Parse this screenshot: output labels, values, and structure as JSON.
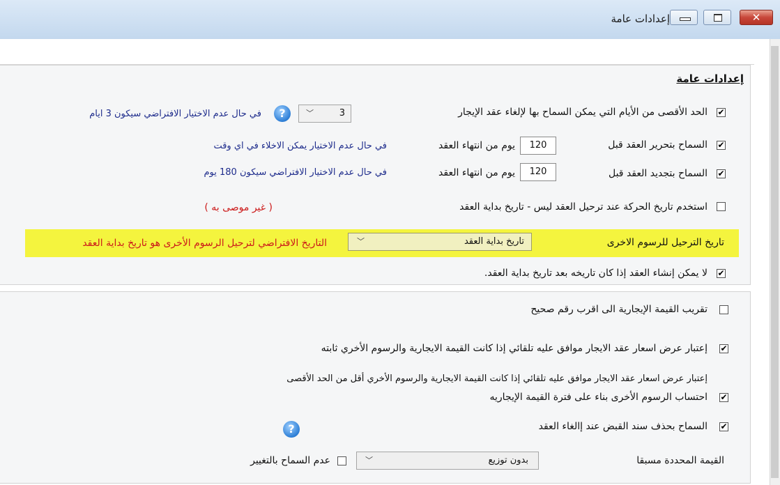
{
  "window": {
    "title": "إعدادات عامة"
  },
  "section_title": "إعدادات عامة",
  "general": {
    "max_cancel_days": {
      "checked": true,
      "label": "الحد الأقصى من الأيام التي يمكن السماح بها لإلغاء عقد الإيجار",
      "value": "3",
      "hint": "في حال عدم الاختيار الافتراضي سيكون 3 ايام"
    },
    "allow_release_before": {
      "checked": true,
      "label": "السماح بتحرير العقد قبل",
      "value": "120",
      "unit": "يوم من انتهاء العقد",
      "hint": "في حال عدم الاختيار يمكن الاخلاء في اي وقت"
    },
    "allow_renew_before": {
      "checked": true,
      "label": "السماح بتجديد العقد قبل",
      "value": "120",
      "unit": "يوم من انتهاء العقد",
      "hint": "في حال عدم الاختيار الافتراضي سيكون 180 يوم"
    },
    "use_movement_date": {
      "checked": false,
      "label": "استخدم تاريخ الحركة عند ترحيل العقد ليس - تاريخ بداية العقد",
      "warning": "( غير موصى به )"
    },
    "other_fees_posting_date": {
      "label": "تاريخ الترحيل للرسوم الاخرى",
      "selected": "تاريخ بداية العقد",
      "note": "التاريخ الافتراضي لترحيل الرسوم الأخرى هو تاريخ بداية العقد"
    },
    "no_contract_after_start": {
      "checked": true,
      "label": "لا يمكن إنشاء العقد إذا كان تاريخه بعد تاريخ بداية العقد."
    }
  },
  "pricing": {
    "round_rent": {
      "checked": false,
      "label": "تقريب القيمة الإيجارية الى اقرب رقم صحيح"
    },
    "auto_approve_offer": {
      "checked": true,
      "label": "إعتبار عرض اسعار عقد الايجار موافق عليه تلقائي  إذا كانت القيمة الايجارية والرسوم الأخري ثابته"
    },
    "auto_approve_note": "إعتبار عرض اسعار عقد الايجار موافق عليه تلقائي  إذا كانت القيمة الايجارية والرسوم الأخري أقل من الحد الأقصى",
    "calc_other_fees": {
      "checked": true,
      "label": "احتساب الرسوم الأخرى بناء على فترة القيمة الإيجاريه"
    },
    "allow_delete_receipt": {
      "checked": true,
      "label": "السماح بحذف سند القبض عند إالغاء العقد"
    },
    "preset_value": {
      "label": "القيمة المحددة مسبقا",
      "selected": "بدون توزيع",
      "no_change": {
        "checked": false,
        "label": "عدم السماح بالتغيير"
      }
    }
  },
  "icons": {
    "help": "help-icon",
    "chevron": "chevron-down-icon",
    "check": "✔"
  }
}
